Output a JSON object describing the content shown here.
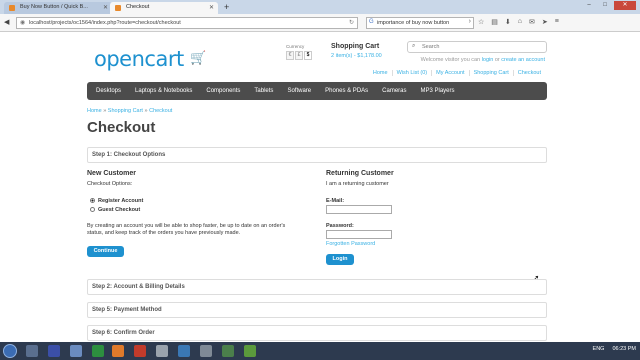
{
  "browser": {
    "tabs": [
      {
        "label": "Buy Now Button / Quick B..."
      },
      {
        "label": "Checkout"
      }
    ],
    "new_tab": "+",
    "window_controls": {
      "minimize": "–",
      "maximize": "□",
      "close": "✕"
    },
    "url": "localhost/projects/oc1564/index.php?route=checkout/checkout",
    "search_value": "importance of buy now button"
  },
  "header": {
    "logo": "opencart",
    "currency_label": "Currency",
    "currency_symbols": [
      "€",
      "£",
      "$"
    ],
    "cart_title": "Shopping Cart",
    "cart_summary": "2 item(s) - $1,178.00",
    "search_placeholder": "Search",
    "welcome_prefix": "Welcome visitor you can",
    "login_link": "login",
    "welcome_or": "or",
    "register_link": "create an account",
    "links": [
      "Home",
      "Wish List (0)",
      "My Account",
      "Shopping Cart",
      "Checkout"
    ]
  },
  "menu": [
    "Desktops",
    "Laptops & Notebooks",
    "Components",
    "Tablets",
    "Software",
    "Phones & PDAs",
    "Cameras",
    "MP3 Players"
  ],
  "breadcrumb": [
    "Home",
    "Shopping Cart",
    "Checkout"
  ],
  "breadcrumb_sep": "»",
  "page_title": "Checkout",
  "steps": {
    "step1": "Step 1: Checkout Options",
    "step2": "Step 2: Account & Billing Details",
    "step5": "Step 5: Payment Method",
    "step6": "Step 6: Confirm Order"
  },
  "new_customer": {
    "title": "New Customer",
    "options_label": "Checkout Options:",
    "register": "Register Account",
    "guest": "Guest Checkout",
    "description": "By creating an account you will be able to shop faster, be up to date on an order's status, and keep track of the orders you have previously made.",
    "continue": "Continue"
  },
  "returning_customer": {
    "title": "Returning Customer",
    "subtitle": "I am a returning customer",
    "email_label": "E-Mail:",
    "password_label": "Password:",
    "forgot": "Forgotten Password",
    "login": "Login"
  },
  "taskbar": {
    "language": "ENG",
    "time": "06:23 PM"
  },
  "colors": {
    "accent": "#1e91cf",
    "menu_bg": "#4c4c4c",
    "link": "#38b0e3"
  }
}
